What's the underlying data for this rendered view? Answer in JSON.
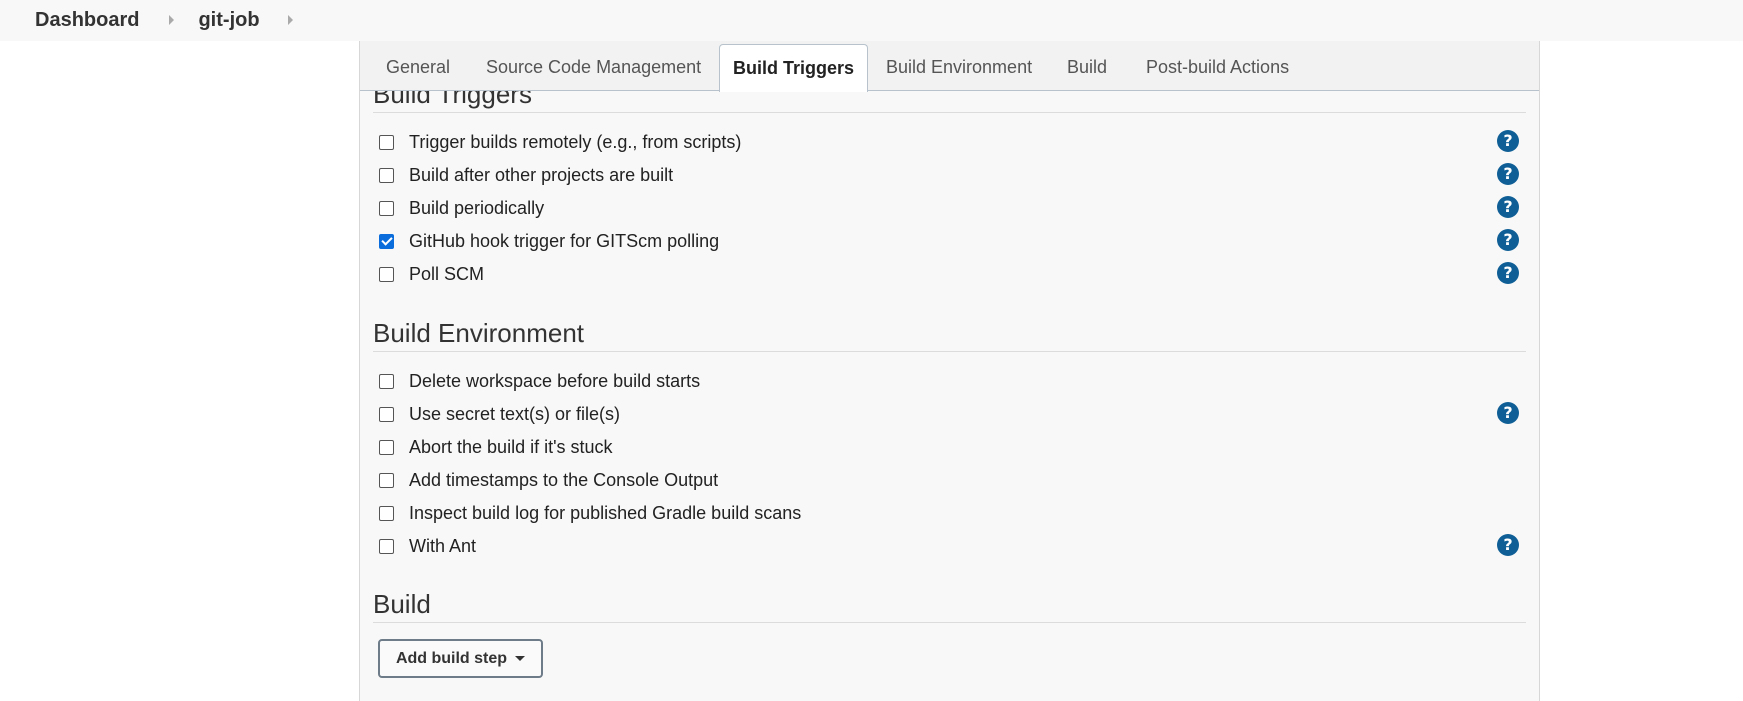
{
  "breadcrumb": {
    "items": [
      "Dashboard",
      "git-job"
    ]
  },
  "tabs": [
    "General",
    "Source Code Management",
    "Build Triggers",
    "Build Environment",
    "Build",
    "Post-build Actions"
  ],
  "active_tab": "Build Triggers",
  "build_triggers": {
    "title": "Build Triggers",
    "options": [
      {
        "label": "Trigger builds remotely (e.g., from scripts)",
        "checked": false,
        "help": true
      },
      {
        "label": "Build after other projects are built",
        "checked": false,
        "help": true
      },
      {
        "label": "Build periodically",
        "checked": false,
        "help": true
      },
      {
        "label": "GitHub hook trigger for GITScm polling",
        "checked": true,
        "help": true
      },
      {
        "label": "Poll SCM",
        "checked": false,
        "help": true
      }
    ]
  },
  "build_environment": {
    "title": "Build Environment",
    "options": [
      {
        "label": "Delete workspace before build starts",
        "checked": false,
        "help": false
      },
      {
        "label": "Use secret text(s) or file(s)",
        "checked": false,
        "help": true
      },
      {
        "label": "Abort the build if it's stuck",
        "checked": false,
        "help": false
      },
      {
        "label": "Add timestamps to the Console Output",
        "checked": false,
        "help": false
      },
      {
        "label": "Inspect build log for published Gradle build scans",
        "checked": false,
        "help": false
      },
      {
        "label": "With Ant",
        "checked": false,
        "help": true
      }
    ]
  },
  "build": {
    "title": "Build",
    "add_step_label": "Add build step"
  },
  "help_glyph": "?",
  "colors": {
    "checkbox_checked": "#0a6ddb",
    "help_icon": "#0f5f96"
  }
}
